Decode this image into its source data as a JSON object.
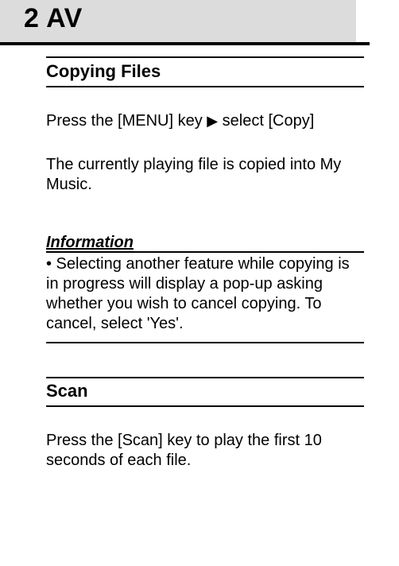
{
  "chapter": {
    "title": "2 AV"
  },
  "section1": {
    "heading": "Copying Files",
    "instruction_prefix": "Press the [MENU] key ",
    "instruction_suffix": " select [Copy]",
    "arrow": "▶",
    "description": "The currently playing file is copied into My Music."
  },
  "info": {
    "heading": "Information",
    "bullet": "• Selecting another feature while copying is in progress will display a pop-up asking whether you wish to cancel copying. To cancel, select 'Yes'."
  },
  "section2": {
    "heading": "Scan",
    "body": "Press the [Scan] key to play the first 10 seconds of each file."
  }
}
